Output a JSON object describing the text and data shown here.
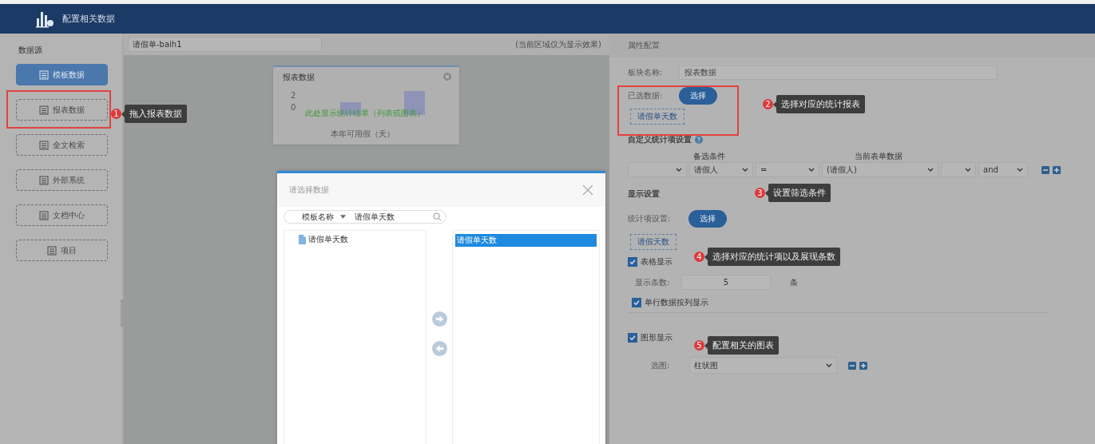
{
  "header": {
    "title": "配置相关数据"
  },
  "sidebar": {
    "title": "数据源",
    "items": [
      {
        "label": "模板数据",
        "selected": true
      },
      {
        "label": "报表数据",
        "selected": false
      },
      {
        "label": "全文检索",
        "selected": false
      },
      {
        "label": "外部系统",
        "selected": false
      },
      {
        "label": "文档中心",
        "selected": false
      },
      {
        "label": "项目",
        "selected": false
      }
    ]
  },
  "canvas": {
    "name_field": "请假单-baih1",
    "hint": "(当前区域仅为显示效果)",
    "card": {
      "title": "报表数据",
      "message": "此处显示统计结果（列表或图表）",
      "axis_caption": "本年可用假（天）",
      "y_labels": [
        "2",
        "0"
      ]
    }
  },
  "dialog": {
    "title": "请选择数据",
    "search_field": "模板名称",
    "search_value": "请假单天数",
    "source_items": [
      {
        "label": "请假单天数"
      }
    ],
    "target_items": [
      {
        "label": "请假单天数",
        "selected": true
      }
    ]
  },
  "properties": {
    "title": "属性配置",
    "block_name": {
      "label": "板块名称:",
      "value": "报表数据"
    },
    "selected_data": {
      "label": "已选数据:",
      "button": "选择",
      "tag": "请假单天数"
    },
    "custom": {
      "title": "自定义统计项设置",
      "columns": [
        "备选条件",
        "当前表单数据"
      ],
      "selects": [
        {
          "kind": "blank"
        },
        {
          "kind": "filled",
          "value": "请假人"
        },
        {
          "kind": "filled",
          "value": "="
        },
        {
          "kind": "filled",
          "value": "(请假人)"
        },
        {
          "kind": "blank"
        },
        {
          "kind": "filled",
          "value": "and"
        }
      ]
    },
    "display": {
      "title": "显示设置",
      "stat_label": "统计项设置:",
      "button": "选择",
      "tag": "请假天数",
      "table_display": {
        "label": "表格显示",
        "checked": true
      },
      "rows_label": "显示条数:",
      "rows_value": "5",
      "rows_unit": "条",
      "by_column": {
        "label": "单行数据按列显示",
        "checked": true
      },
      "chart_display": {
        "label": "图形显示",
        "checked": true
      },
      "chart_type_label": "选图:",
      "chart_type": "柱状图"
    }
  },
  "annotations": [
    {
      "number": "1",
      "text": "拖入报表数据"
    },
    {
      "number": "2",
      "text": "选择对应的统计报表"
    },
    {
      "number": "3",
      "text": "设置筛选条件"
    },
    {
      "number": "4",
      "text": "选择对应的统计项以及展现条数"
    },
    {
      "number": "5",
      "text": "配置相关的图表"
    }
  ]
}
